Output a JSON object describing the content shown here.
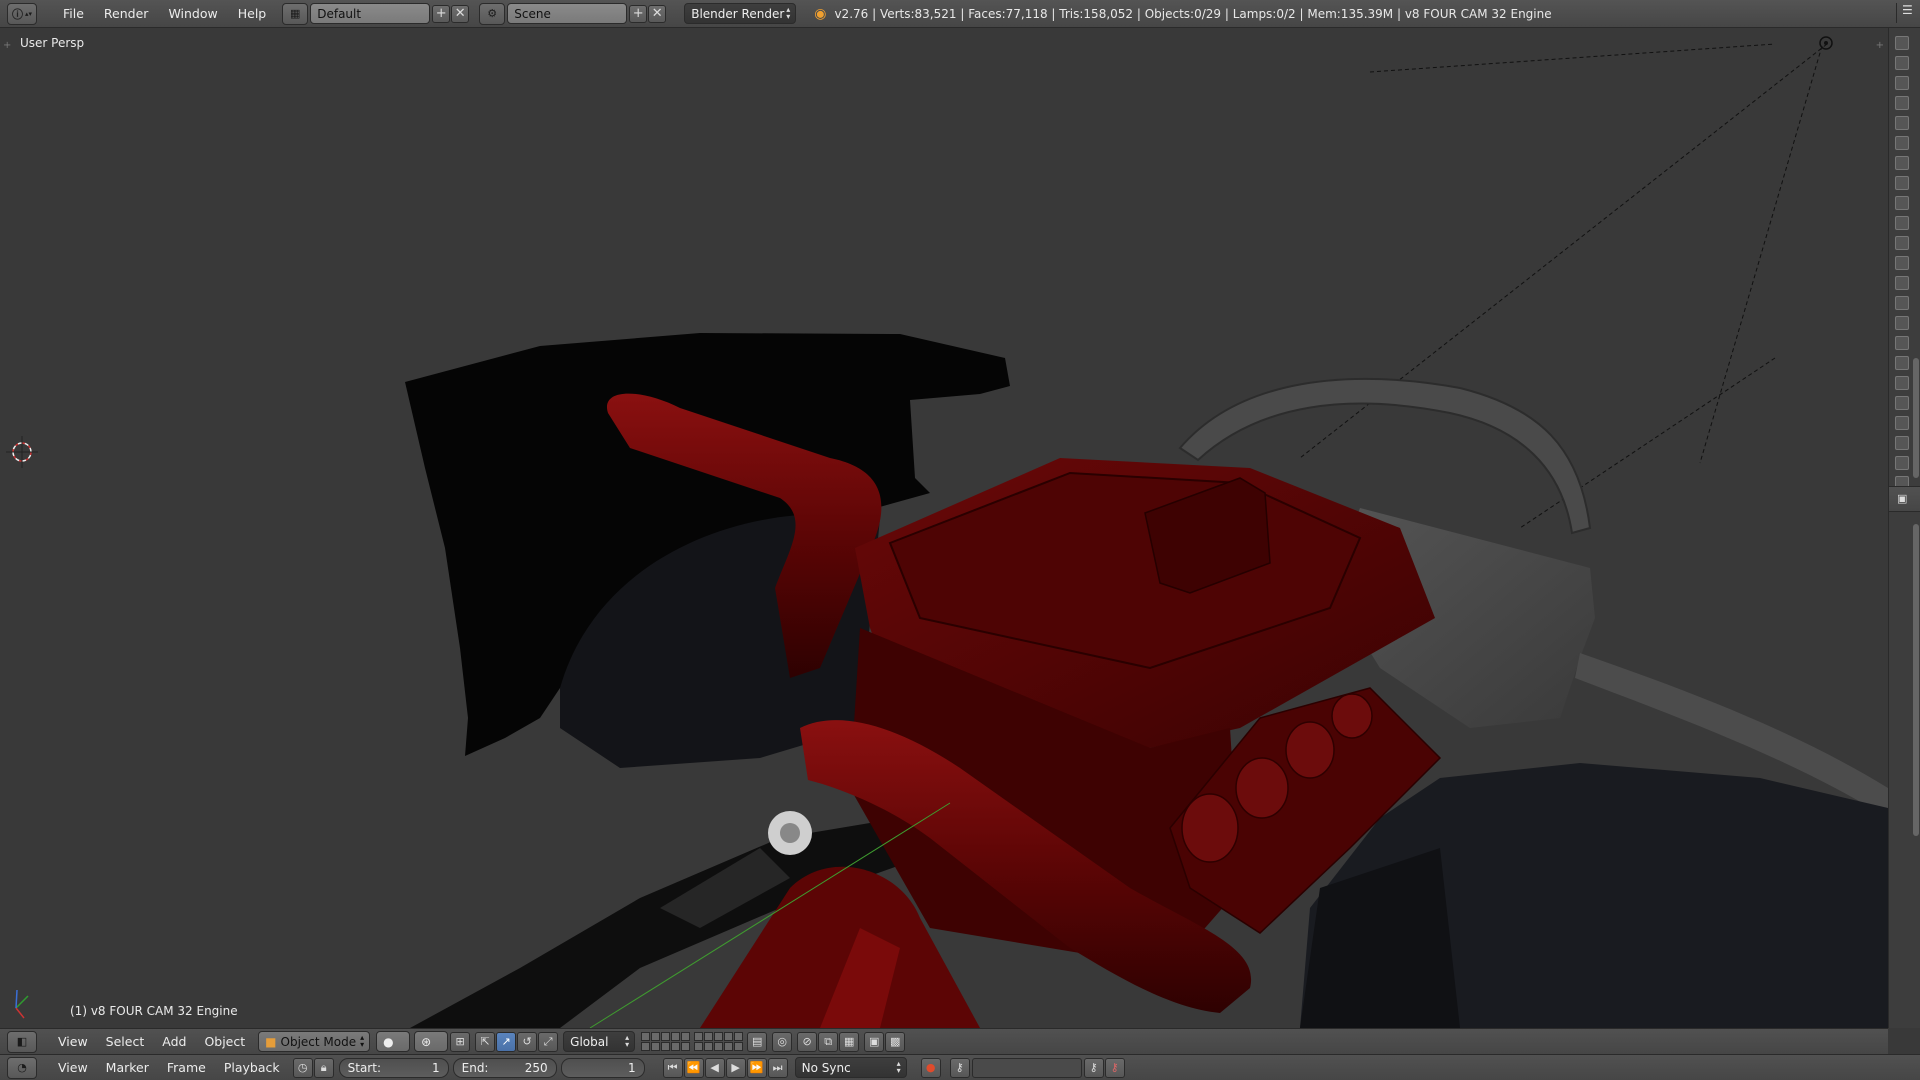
{
  "top": {
    "menus": [
      "File",
      "Render",
      "Window",
      "Help"
    ],
    "layout": "Default",
    "scene": "Scene",
    "engine": "Blender Render",
    "stats": "v2.76 | Verts:83,521 | Faces:77,118 | Tris:158,052 | Objects:0/29 | Lamps:0/2 | Mem:135.39M | v8 FOUR CAM 32 Engine"
  },
  "viewport": {
    "perspective": "User Persp",
    "object_name": "(1) v8 FOUR CAM 32 Engine"
  },
  "view3d_header": {
    "menus": [
      "View",
      "Select",
      "Add",
      "Object"
    ],
    "mode": "Object Mode",
    "orientation": "Global"
  },
  "timeline_header": {
    "menus": [
      "View",
      "Marker",
      "Frame",
      "Playback"
    ],
    "start_label": "Start:",
    "start_value": "1",
    "end_label": "End:",
    "end_value": "250",
    "current_frame": "1",
    "sync": "No Sync"
  },
  "icons": {
    "info": "info-icon",
    "screen": "screen-layout-icon",
    "scene": "scene-icon",
    "blender": "blender-logo-icon",
    "add": "plus-icon",
    "remove": "x-icon",
    "record": "record-icon",
    "key": "keying-icon"
  },
  "colors": {
    "engine_red": "#5a0404",
    "background": "#393939",
    "header": "#4b4b4b",
    "accent_blue": "#5680c2"
  }
}
